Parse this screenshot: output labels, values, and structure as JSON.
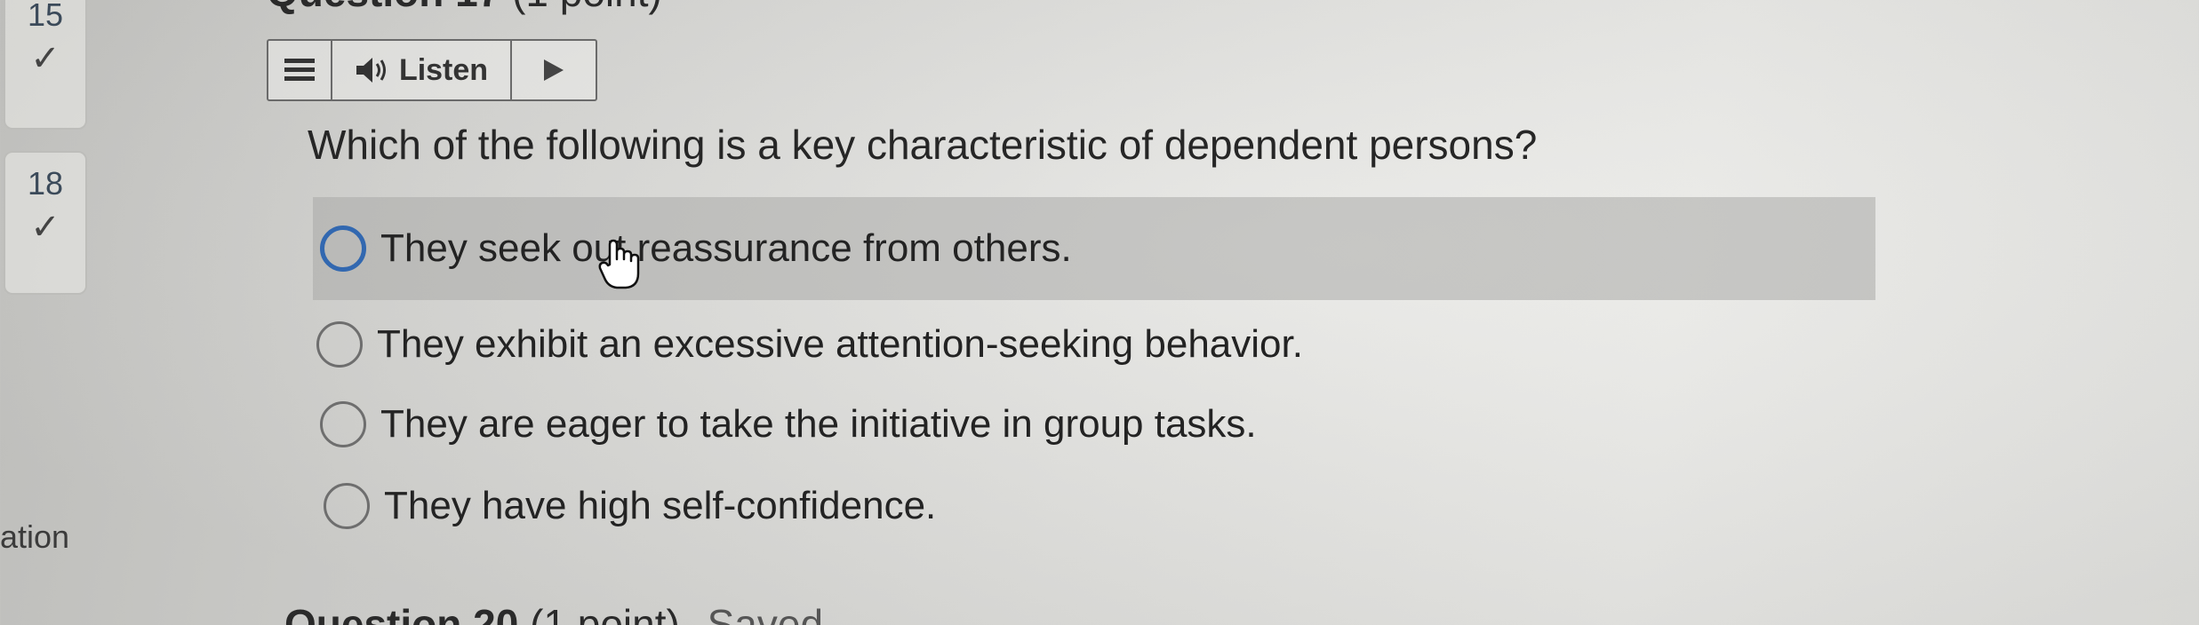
{
  "question_nav": [
    {
      "number": "15",
      "status_icon": "check-icon"
    },
    {
      "number": "18",
      "status_icon": "check-icon"
    }
  ],
  "side_fragment": "ation",
  "question_header": {
    "title": "Question 17",
    "points": "(1 point)"
  },
  "toolbar": {
    "menu_icon": "menu-icon",
    "speaker_icon": "speaker-icon",
    "listen_label": "Listen",
    "play_icon": "play-icon"
  },
  "question": {
    "text": "Which of the following is a key characteristic of dependent persons?",
    "options": [
      {
        "label": "They seek out reassurance from others.",
        "selected": true
      },
      {
        "label": "They exhibit an excessive attention-seeking behavior.",
        "selected": false
      },
      {
        "label": "They are eager to take the initiative in group tasks.",
        "selected": false
      },
      {
        "label": "They have high self-confidence.",
        "selected": false
      }
    ]
  },
  "next_question_header": {
    "title": "Question 20",
    "points": "(1 point)",
    "saved": "Saved"
  },
  "colors": {
    "selected_radio": "#3268b0",
    "selected_row": "#aaaaa8"
  }
}
